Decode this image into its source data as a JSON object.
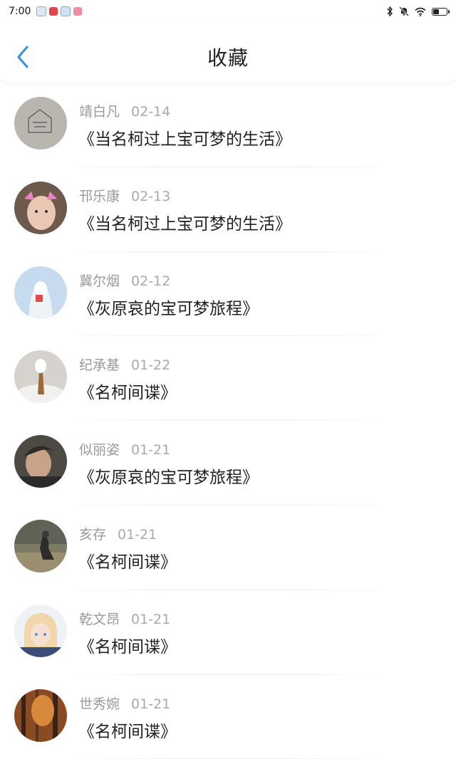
{
  "status_bar": {
    "time": "7:00",
    "notification_icons": [
      "mail-app-icon",
      "red-app-icon",
      "shield-app-icon",
      "pink-app-icon"
    ],
    "system_icons": [
      "bluetooth-icon",
      "mute-icon",
      "wifi-icon",
      "battery-icon"
    ],
    "battery_level": 0.4
  },
  "header": {
    "title": "收藏"
  },
  "favorites": [
    {
      "author": "靖白凡",
      "date": "02-14",
      "title": "《当名柯过上宝可梦的生活》"
    },
    {
      "author": "邗乐康",
      "date": "02-13",
      "title": "《当名柯过上宝可梦的生活》"
    },
    {
      "author": "冀尔烟",
      "date": "02-12",
      "title": "《灰原哀的宝可梦旅程》"
    },
    {
      "author": "纪承基",
      "date": "01-22",
      "title": "《名柯间谍》"
    },
    {
      "author": "似丽姿",
      "date": "01-21",
      "title": "《灰原哀的宝可梦旅程》"
    },
    {
      "author": "亥存",
      "date": "01-21",
      "title": "《名柯间谍》"
    },
    {
      "author": "乾文昂",
      "date": "01-21",
      "title": "《名柯间谍》"
    },
    {
      "author": "世秀婉",
      "date": "01-21",
      "title": "《名柯间谍》"
    }
  ],
  "colors": {
    "accent": "#3a8ee6",
    "title_text": "#222222",
    "meta_text": "#999999"
  }
}
